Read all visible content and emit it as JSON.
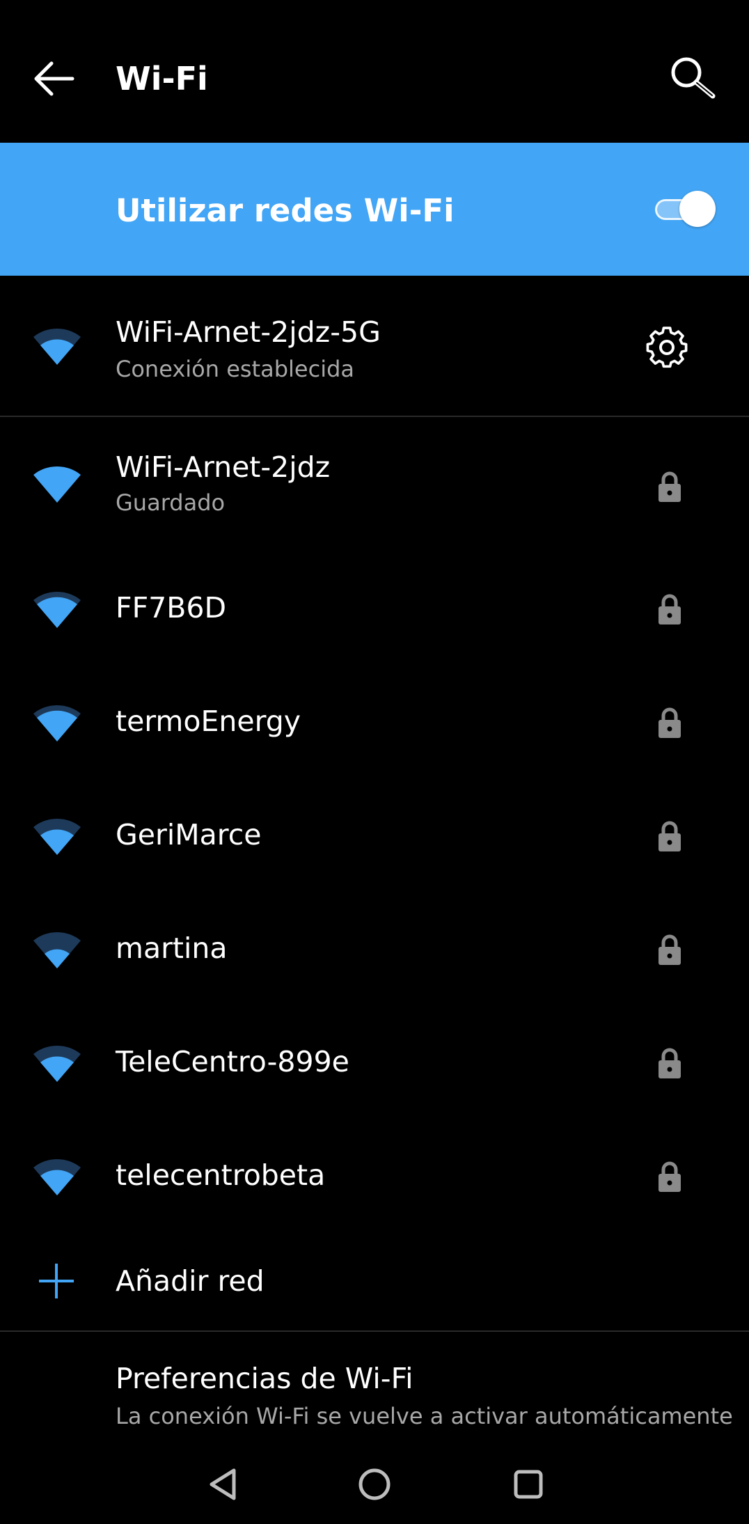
{
  "appbar": {
    "title": "Wi-Fi",
    "back_icon": "arrow-back-icon",
    "search_icon": "search-icon"
  },
  "master_toggle": {
    "label": "Utilizar redes Wi-Fi",
    "state": "on",
    "background": "#42a5f5"
  },
  "connected": {
    "name": "WiFi-Arnet-2jdz-5G",
    "status": "Conexión establecida",
    "settings_icon": "gear-icon"
  },
  "networks": [
    {
      "name": "WiFi-Arnet-2jdz",
      "status": "Guardado"
    },
    {
      "name": "FF7B6D"
    },
    {
      "name": "termoEnergy"
    },
    {
      "name": "GeriMarce"
    },
    {
      "name": "martina"
    },
    {
      "name": "TeleCentro-899e"
    },
    {
      "name": "telecentrobeta"
    }
  ],
  "add_network": {
    "label": "Añadir red",
    "icon": "plus-icon"
  },
  "preferences": {
    "title": "Preferencias de Wi-Fi",
    "subtitle": "La conexión Wi-Fi se vuelve a activar automáticamente"
  },
  "colors": {
    "accent": "#42a5f5",
    "signal_dim": "#1e3a5a",
    "lock": "#8a8a8a"
  }
}
